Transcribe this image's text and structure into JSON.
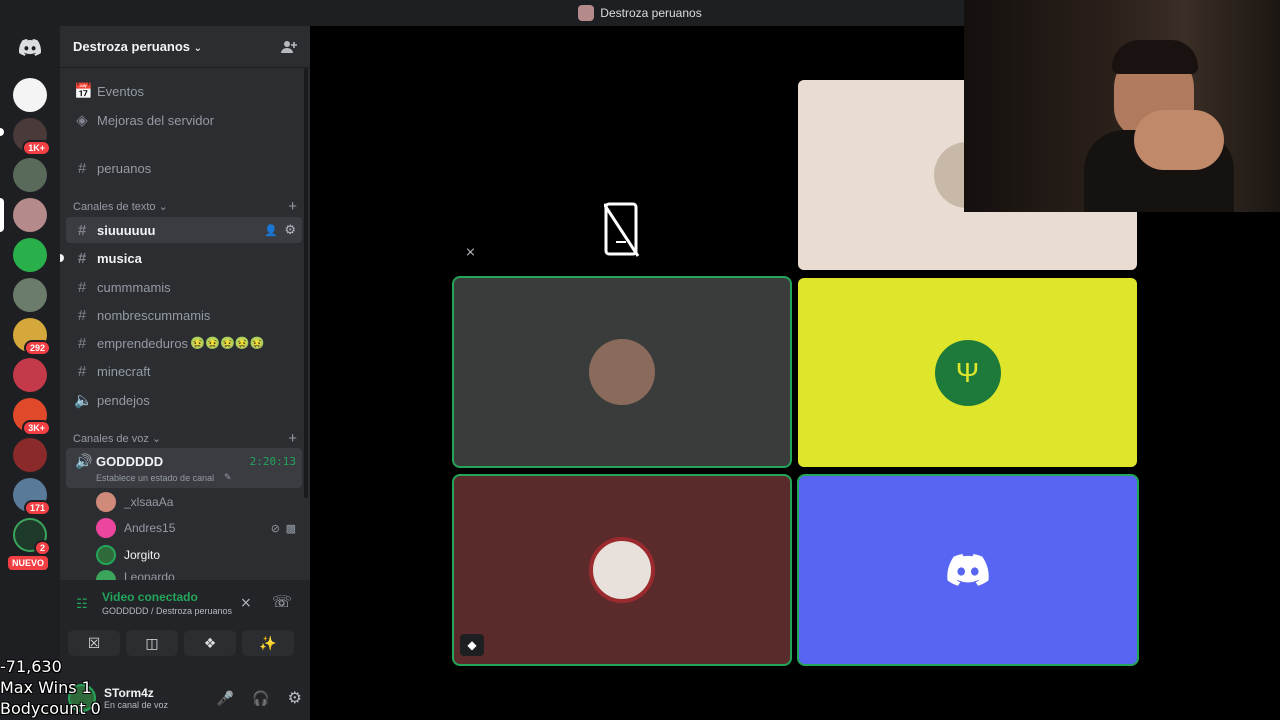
{
  "titlebar": {
    "title": "Destroza peruanos"
  },
  "rail": {
    "badges": [
      "1K+",
      "292",
      "3K+",
      "171",
      "2"
    ],
    "new_label": "NUEVO"
  },
  "sidebar": {
    "server_name": "Destroza peruanos",
    "top_items": [
      {
        "label": "Eventos",
        "icon": "calendar-icon"
      },
      {
        "label": "Mejoras del servidor",
        "icon": "boost-icon"
      },
      {
        "label": "peruanos",
        "icon": "hash-icon"
      }
    ],
    "text_category": "Canales de texto",
    "text_channels": [
      {
        "label": "siuuuuuu",
        "icon": "hash-icon"
      },
      {
        "label": "musica",
        "icon": "hash-icon"
      },
      {
        "label": "cummmamis",
        "icon": "hash-icon"
      },
      {
        "label": "nombrescummamis",
        "icon": "hash-icon"
      },
      {
        "label": "emprendeduros",
        "icon": "hash-icon",
        "emoji": "🤢🤢🤢🤢🤢"
      },
      {
        "label": "minecraft",
        "icon": "hash-icon"
      },
      {
        "label": "pendejos",
        "icon": "speaker-icon"
      }
    ],
    "voice_category": "Canales de voz",
    "voice_channel": {
      "name": "GODDDDD",
      "timer": "2:20:13",
      "status_placeholder": "Establece un estado de canal"
    },
    "voice_users": [
      {
        "name": "_xlsaaAa",
        "color": "#d08a7a"
      },
      {
        "name": "Andres15",
        "color": "#eb459e"
      },
      {
        "name": "Jorgito",
        "color": "#2f6b3a"
      },
      {
        "name": "Leonardo",
        "color": "#3ba55c"
      }
    ]
  },
  "voice_panel": {
    "status": "Video conectado",
    "location": "GODDDDD / Destroza peruanos"
  },
  "user_panel": {
    "username": "STorm4z",
    "substatus": "En canal de voz"
  },
  "overlay": {
    "line1": "-71,630",
    "line2": "Max Wins 1",
    "line3": "Bodycount 0"
  },
  "colors": {
    "accent_green": "#23a55a",
    "tile_gray": "#3a3c3b",
    "tile_yellow": "#dfe52b",
    "tile_maroon": "#5b2a2b",
    "tile_blurple": "#5865f2",
    "tile_beige": "#e9ddd3"
  }
}
